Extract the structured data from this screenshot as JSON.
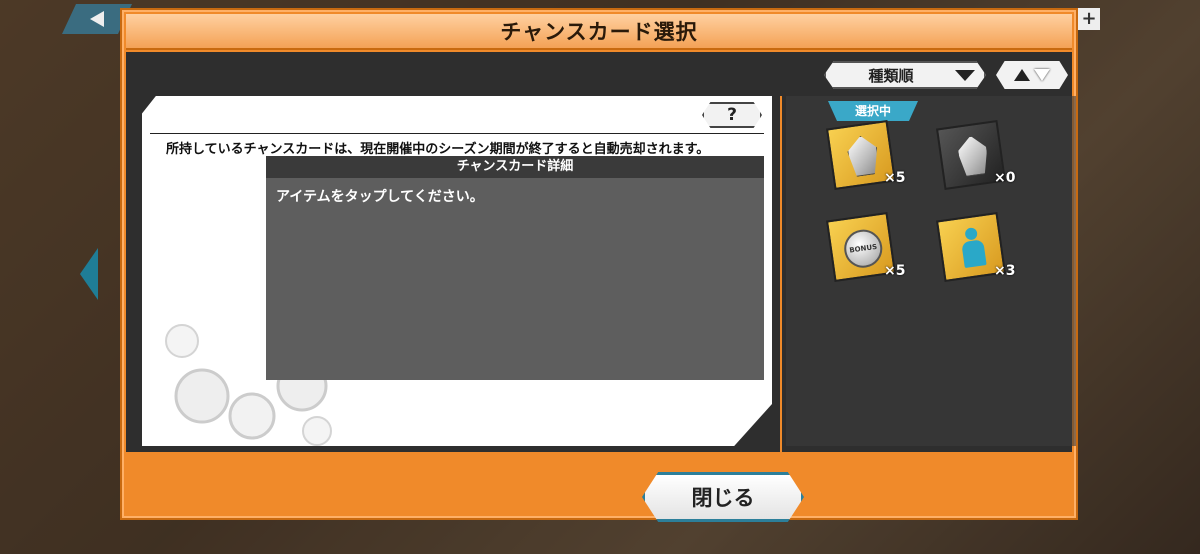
{
  "modal": {
    "title": "チャンスカード選択",
    "close_label": "閉じる"
  },
  "sort": {
    "selected": "種類順",
    "order_icon": "up-down-arrows-icon"
  },
  "info": {
    "help_label": "?",
    "notice": "所持しているチャンスカードは、現在開催中のシーズン期間が終了すると自動売却されます。",
    "detail_header": "チャンスカード詳細",
    "detail_text": "アイテムをタップしてください。"
  },
  "cards": {
    "selected_badge": "選択中",
    "items": [
      {
        "icon": "silver-gem-card-icon",
        "count": "×5"
      },
      {
        "icon": "dark-gem-card-icon",
        "count": "×0"
      },
      {
        "icon": "bonus-coin-card-icon",
        "count": "×5",
        "coin_text": "BONUS"
      },
      {
        "icon": "party-member-card-icon",
        "count": "×3"
      }
    ]
  },
  "colors": {
    "frame_orange": "#f08a2a",
    "accent_teal": "#2c7f9a",
    "badge_blue": "#3aa8c8"
  }
}
